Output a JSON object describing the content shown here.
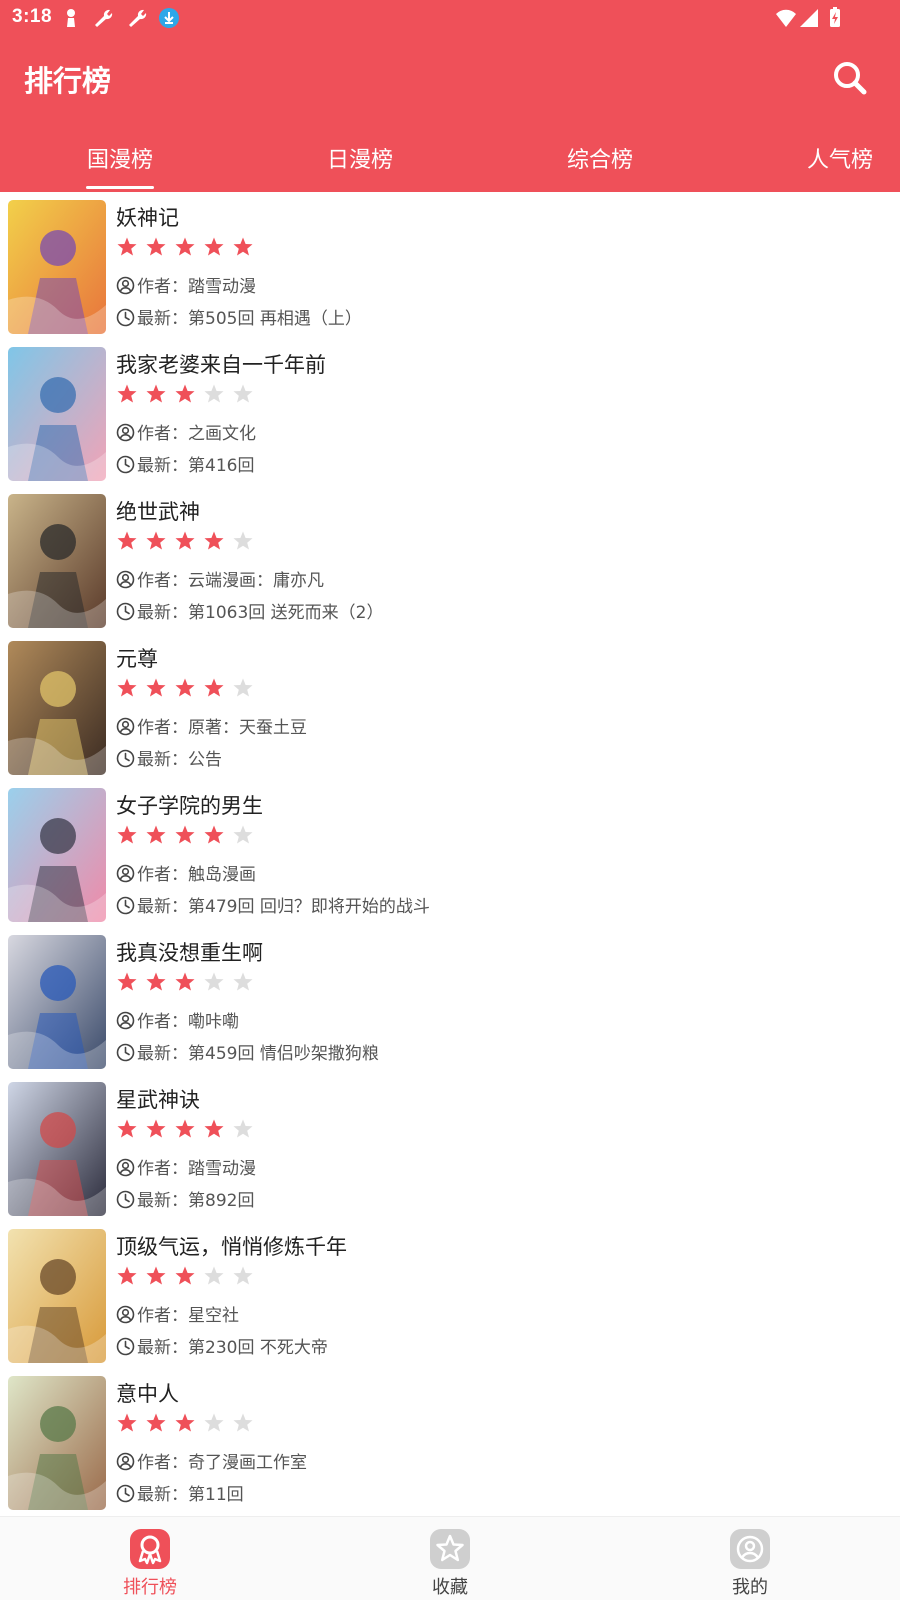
{
  "status_bar": {
    "time": "3:18"
  },
  "header": {
    "title": "排行榜",
    "search_icon": "search-icon",
    "color": "#ef5059"
  },
  "tabs": [
    {
      "label": "国漫榜",
      "active": true
    },
    {
      "label": "日漫榜",
      "active": false
    },
    {
      "label": "综合榜",
      "active": false
    },
    {
      "label": "人气榜",
      "active": false
    }
  ],
  "list_labels": {
    "author_prefix": "作者：",
    "latest_prefix": "最新："
  },
  "comics": [
    {
      "title": "妖神记",
      "rating": 5,
      "author": "踏雪动漫",
      "latest": "第505回 再相遇（上）"
    },
    {
      "title": "我家老婆来自一千年前",
      "rating": 3,
      "author": "之画文化",
      "latest": "第416回"
    },
    {
      "title": "绝世武神",
      "rating": 4,
      "author": "云端漫画：庸亦凡",
      "latest": "第1063回 送死而来（2）"
    },
    {
      "title": "元尊",
      "rating": 4,
      "author": "原著：天蚕土豆",
      "latest": "公告"
    },
    {
      "title": "女子学院的男生",
      "rating": 4,
      "author": "触岛漫画",
      "latest": "第479回 回归？即将开始的战斗"
    },
    {
      "title": "我真没想重生啊",
      "rating": 3,
      "author": "嘞咔嘞",
      "latest": "第459回 情侣吵架撒狗粮"
    },
    {
      "title": "星武神诀",
      "rating": 4,
      "author": "踏雪动漫",
      "latest": "第892回"
    },
    {
      "title": "顶级气运，悄悄修炼千年",
      "rating": 3,
      "author": "星空社",
      "latest": "第230回 不死大帝"
    },
    {
      "title": "意中人",
      "rating": 3,
      "author": "奇了漫画工作室",
      "latest": "第11回"
    }
  ],
  "bottom_nav": [
    {
      "label": "排行榜",
      "icon": "ranking-icon",
      "active": true
    },
    {
      "label": "收藏",
      "icon": "star-icon",
      "active": false
    },
    {
      "label": "我的",
      "icon": "profile-icon",
      "active": false
    }
  ],
  "colors": {
    "accent": "#ef5059",
    "star_on": "#ef5059",
    "star_off": "#dddddd"
  }
}
